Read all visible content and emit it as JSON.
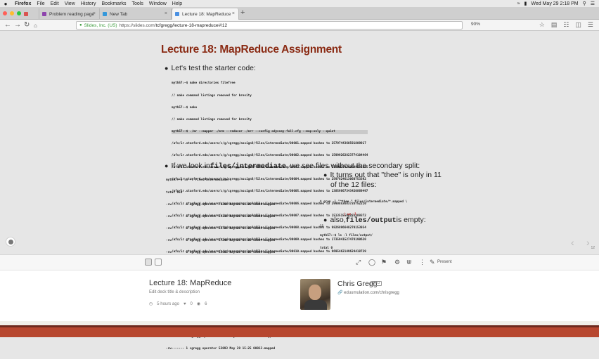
{
  "menubar": {
    "app": "Firefox",
    "items": [
      "File",
      "Edit",
      "View",
      "History",
      "Bookmarks",
      "Tools",
      "Window",
      "Help"
    ],
    "clock": "Wed May 29 2:18 PM"
  },
  "tabs": [
    {
      "label": "",
      "color": "#d9534f"
    },
    {
      "label": "Problem reading page",
      "color": "#8e44ad"
    },
    {
      "label": "New Tab",
      "color": "#3498db"
    },
    {
      "label": "Lecture 18: MapReduce",
      "color": "#4a90e2"
    }
  ],
  "navbar": {
    "site": "Slides, Inc. (US)",
    "url_prefix": "https://slides.com/",
    "url_rest": "tcfgregg/lecture-18-mapreduce#/12",
    "zoom": "90%"
  },
  "slide": {
    "title": "Lecture 18: MapReduce Assignment",
    "bullet1": "Let's test the starter code:",
    "bullet2_pre": "If we look in ",
    "bullet2_code": "files/intermediate",
    "bullet2_post": ", we see files without the secondary split:",
    "bullet3": "It turns out that \"thee\" is only in 11 of the 12 files:",
    "bullet3_line1": "It turns out that \"thee\" is only in 11",
    "bullet3_line2": "of the 12 files:",
    "bullet4_pre": "also, ",
    "bullet4_code": "files/output",
    "bullet4_post": " is empty:",
    "code1": [
      "myth57:~$ make directories filefree",
      "// make command listings removed for brevity",
      "myth57:~$ make",
      "// make command listings removed for brevity",
      "myth57:~$ ./mr --mapper ./mrm --reducer ./mrr --config odyssey-full.cfg --map-only --quiet",
      "/afs/ir.stanford.edu/users/c/g/cgregg/assign8/files/intermediate/00001.mapped hashes to 2579744360591809917",
      "/afs/ir.stanford.edu/users/c/g/cgregg/assign8/files/intermediate/00002.mapped hashes to 15999262823774104464",
      "/afs/ir.stanford.edu/users/c/g/cgregg/assign8/files/intermediate/00003.mapped hashes to 15899254360098592385",
      "/afs/ir.stanford.edu/users/c/g/cgregg/assign8/files/intermediate/00004.mapped hashes to 2597624613060753392",
      "/afs/ir.stanford.edu/users/c/g/cgregg/assign8/files/intermediate/00005.mapped hashes to 13859867343420869497",
      "/afs/ir.stanford.edu/users/c/g/cgregg/assign8/files/intermediate/00006.mapped hashes to 2990853683726752210",
      "/afs/ir.stanford.edu/users/c/g/cgregg/assign8/files/intermediate/00007.mapped hashes to 1513515500283389372",
      "/afs/ir.stanford.edu/users/c/g/cgregg/assign8/files/intermediate/00008.mapped hashes to 9826896648270153934",
      "/afs/ir.stanford.edu/users/c/g/cgregg/assign8/files/intermediate/00009.mapped hashes to 1735941527478190620",
      "/afs/ir.stanford.edu/users/c/g/cgregg/assign8/files/intermediate/00010.mapped hashes to 9695462149624418729",
      "/afs/ir.stanford.edu/users/c/g/cgregg/assign8/files/intermediate/00011.mapped hashes to 5398029259362325432",
      "/afs/ir.stanford.edu/users/c/g/cgregg/assign8/files/intermediate/00012.mapped hashes to 1375045273327519804",
      "myth57:~$"
    ],
    "code2": [
      "myth57:~$ ls -l files/intermediate/",
      "total 655",
      "-rw------- 1 cgregg operator 76280 May 29 15:25 00001.mapped",
      "-rw------- 1 cgregg operator 54138 May 29 15:25 00002.mapped",
      "-rw------- 1 cgregg operator 53728 May 29 15:25 00003.mapped",
      "-rw------- 1 cgregg operator 57249 May 29 15:25 00004.mapped",
      "-rw------- 1 cgregg operator 53683 May 29 15:25 00005.mapped",
      "-rw------- 1 cgregg operator 52183 May 29 15:25 00006.mapped",
      "-rw------- 1 cgregg operator 58654 May 29 15:25 00007.mapped",
      "-rw------- 1 cgregg operator 55080 May 29 15:25 00008.mapped",
      "-rw------- 1 cgregg operator 52089 May 29 15:25 00009.mapped",
      "-rw------- 1 cgregg operator 53163 May 29 15:25 00010.mapped",
      "-rw------- 1 cgregg operator 53326 May 29 15:25 00011.mapped",
      "-rw------- 1 cgregg operator 52183 May 29 15:25 00012.mapped",
      "-rw------- 1 cgregg operator 52093 May 29 15:25 00013.mapped"
    ],
    "code3_line1": "$ grep -l \"^thee \" files/intermediate/*.mapped \\",
    "code3_line2": "| wc -l",
    "code3_line3": "11",
    "code4": [
      "myth57:~$ ls -l files/output/",
      "total 0"
    ],
    "slide_number": "12"
  },
  "panel": {
    "present_label": "Present",
    "deck_title": "Lecture 18: MapReduce",
    "deck_edit": "Edit deck title & description",
    "time_ago": "5 hours ago",
    "likes": "0",
    "views": "6",
    "author": "Chris Gregg",
    "author_badge": "PRO",
    "author_link": "eduumulation.com/chrisgregg"
  },
  "colors": {
    "title": "#8a2a13",
    "dock": "#b7472f"
  }
}
